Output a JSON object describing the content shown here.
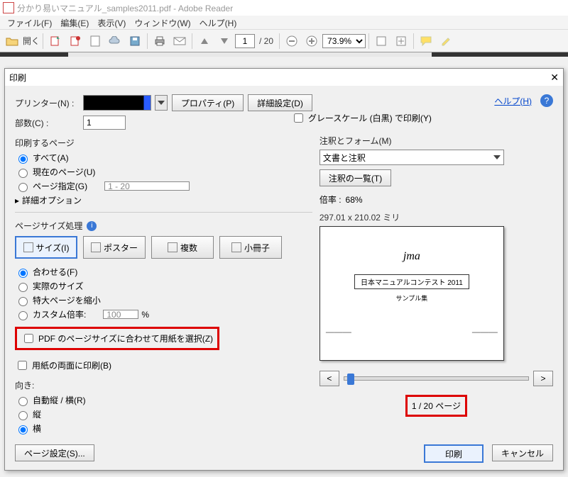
{
  "window": {
    "title": "分かり易いマニュアル_samples2011.pdf - Adobe Reader"
  },
  "menu": {
    "file": "ファイル(F)",
    "edit": "編集(E)",
    "view": "表示(V)",
    "window": "ウィンドウ(W)",
    "help": "ヘルプ(H)"
  },
  "toolbar": {
    "open": "開く",
    "page_current": "1",
    "page_total": "/ 20",
    "zoom": "73.9%"
  },
  "dialog": {
    "title": "印刷",
    "printer_label": "プリンター(N) :",
    "properties": "プロパティ(P)",
    "advanced": "詳細設定(D)",
    "help": "ヘルプ(H)",
    "copies_label": "部数(C) :",
    "copies_value": "1",
    "grayscale": "グレースケール (白黒) で印刷(Y)",
    "pages_header": "印刷するページ",
    "rad_all": "すべて(A)",
    "rad_current": "現在のページ(U)",
    "rad_range": "ページ指定(G)",
    "range_value": "1 - 20",
    "more_options": "詳細オプション",
    "size_header": "ページサイズ処理",
    "tab_size": "サイズ(I)",
    "tab_poster": "ポスター",
    "tab_multi": "複数",
    "tab_booklet": "小冊子",
    "fit": "合わせる(F)",
    "actual": "実際のサイズ",
    "shrink": "特大ページを縮小",
    "custom_scale": "カスタム倍率:",
    "custom_scale_value": "100",
    "percent": "%",
    "choose_paper": "PDF のページサイズに合わせて用紙を選択(Z)",
    "duplex": "用紙の両面に印刷(B)",
    "orientation_header": "向き:",
    "or_auto": "自動縦 / 横(R)",
    "or_portrait": "縦",
    "or_landscape": "横",
    "ann_header": "注釈とフォーム(M)",
    "ann_value": "文書と注釈",
    "ann_list": "注釈の一覧(T)",
    "scale_label": "倍率 :",
    "scale_value": "68%",
    "preview_dim": "297.01 x 210.02 ミリ",
    "preview_title": "日本マニュアルコンテスト 2011",
    "preview_sub": "サンプル集",
    "page_indicator": "1 / 20 ページ",
    "page_setup": "ページ設定(S)...",
    "print": "印刷",
    "cancel": "キャンセル",
    "nav_prev": "<",
    "nav_next": ">"
  }
}
